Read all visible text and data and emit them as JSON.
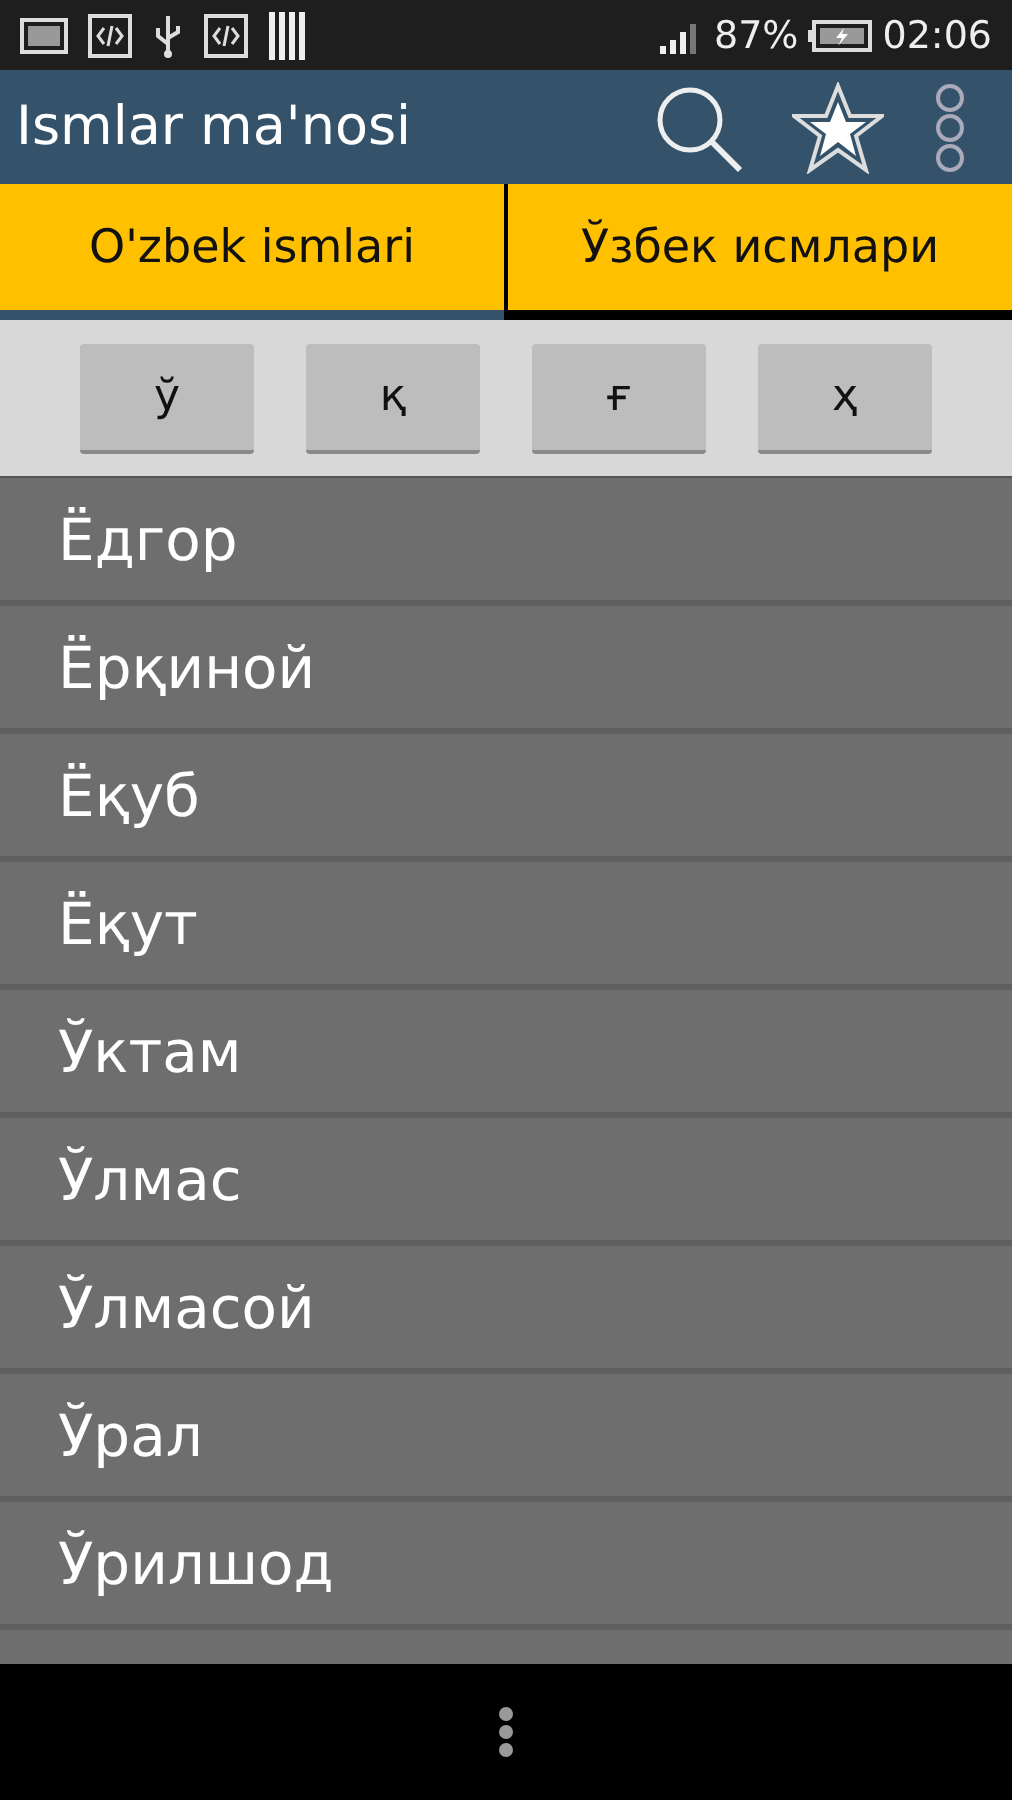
{
  "status_bar": {
    "battery": "87%",
    "time": "02:06"
  },
  "action_bar": {
    "title": "Ismlar ma'nosi"
  },
  "tabs": [
    {
      "label": "O'zbek ismlari",
      "selected": true
    },
    {
      "label": "Ўзбек исмлари",
      "selected": false
    }
  ],
  "letters": [
    "ў",
    "қ",
    "ғ",
    "ҳ"
  ],
  "names": [
    "Ёдгор",
    "Ёрқиной",
    "Ёқуб",
    "Ёқут",
    "Ўктам",
    "Ўлмас",
    "Ўлмасой",
    "Ўрал",
    "Ўрилшод"
  ]
}
